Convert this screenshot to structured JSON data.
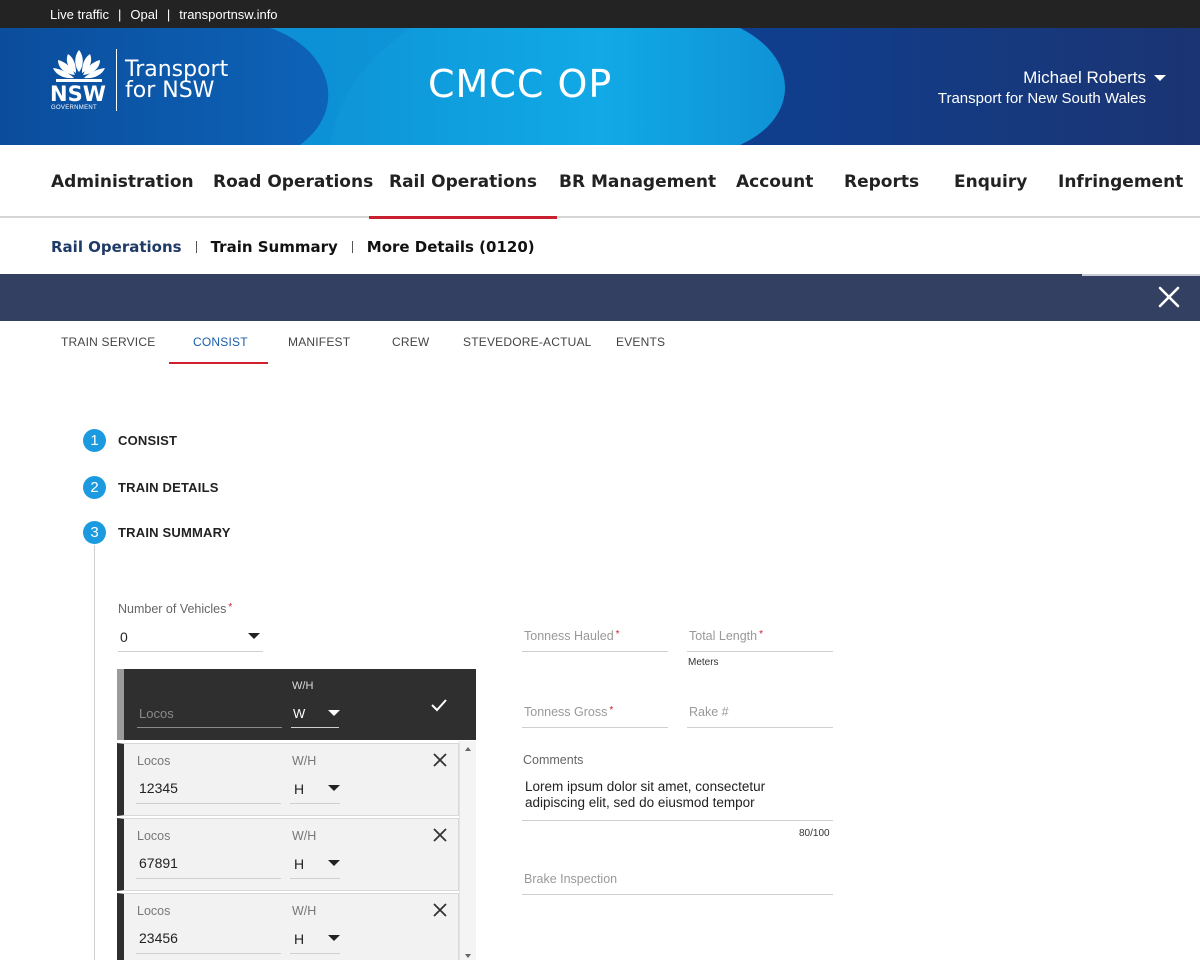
{
  "utility": {
    "links": [
      "Live traffic",
      "Opal",
      "transportnsw.info"
    ]
  },
  "header": {
    "logo_mark": "NSW",
    "logo_gov": "GOVERNMENT",
    "logo_line1": "Transport",
    "logo_line2": "for NSW",
    "app_title": "CMCC OP",
    "user_name": "Michael Roberts",
    "user_org": "Transport for New South Wales"
  },
  "nav": {
    "items": [
      "Administration",
      "Road Operations",
      "Rail Operations",
      "BR Management",
      "Account",
      "Reports",
      "Enquiry",
      "Infringement"
    ],
    "active": "Rail Operations"
  },
  "breadcrumb": {
    "items": [
      "Rail Operations",
      "Train Summary",
      "More Details (0120)"
    ]
  },
  "tabs": {
    "items": [
      "TRAIN SERVICE",
      "CONSIST",
      "MANIFEST",
      "CREW",
      "STEVEDORE-ACTUAL",
      "EVENTS"
    ],
    "active": "CONSIST"
  },
  "steps": [
    {
      "num": "1",
      "label": "CONSIST"
    },
    {
      "num": "2",
      "label": "TRAIN DETAILS"
    },
    {
      "num": "3",
      "label": "TRAIN SUMMARY"
    }
  ],
  "form": {
    "vehicles_label": "Number of Vehicles",
    "vehicles_value": "0",
    "required_mark": "*",
    "new_loco": {
      "wh_label": "W/H",
      "locos_placeholder": "Locos",
      "wh_value": "W"
    },
    "locos": [
      {
        "label": "Locos",
        "value": "12345",
        "wh_label": "W/H",
        "wh_value": "H"
      },
      {
        "label": "Locos",
        "value": "67891",
        "wh_label": "W/H",
        "wh_value": "H"
      },
      {
        "label": "Locos",
        "value": "23456",
        "wh_label": "W/H",
        "wh_value": "H"
      }
    ],
    "tonness_hauled": "Tonness Hauled",
    "total_length": "Total Length",
    "length_unit": "Meters",
    "tonness_gross": "Tonness Gross",
    "rake": "Rake #",
    "comments_label": "Comments",
    "comments_value": "Lorem ipsum dolor sit amet, consectetur adipiscing elit, sed do eiusmod tempor",
    "comments_count": "80/100",
    "brake_inspection": "Brake Inspection"
  },
  "colors": {
    "nav_active": "#c8202f",
    "band": "#334062",
    "step": "#1b9ae0",
    "tab_active": "#1a5ea8"
  }
}
